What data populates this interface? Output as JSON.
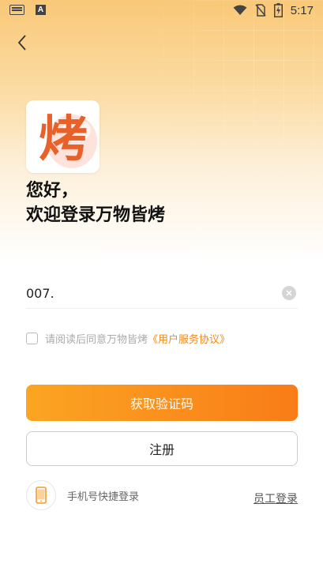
{
  "status_bar": {
    "time": "5:17",
    "left_icons": [
      "keyboard-icon",
      "a-letter-icon"
    ],
    "right_icons": [
      "wifi-icon",
      "no-sim-icon",
      "battery-charging-icon"
    ]
  },
  "header": {
    "back_icon": "chevron-left-icon"
  },
  "logo": {
    "glyph": "烤",
    "accent_color": "#e8602a"
  },
  "greeting": {
    "line1": "您好，",
    "line2": "欢迎登录万物皆烤"
  },
  "phone": {
    "value": "007.",
    "clear_icon": "clear-icon"
  },
  "agreement": {
    "text": "请阅读后同意万物皆烤",
    "link": "《用户服务协议》",
    "checked": false
  },
  "buttons": {
    "get_code": "获取验证码",
    "register": "注册"
  },
  "quick_login": {
    "icon": "phone-icon",
    "label": "手机号快捷登录"
  },
  "staff_login": "员工登录",
  "colors": {
    "primary_start": "#fba522",
    "primary_end": "#f97c18",
    "link": "#f08a1c"
  }
}
